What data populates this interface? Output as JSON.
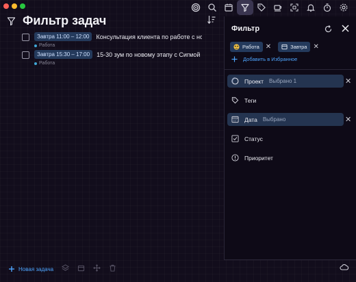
{
  "main": {
    "title": "Фильтр задач",
    "tasks": [
      {
        "time": "Завтра 11:00 – 12:00",
        "title": "Консультация клиента по работе с новым",
        "project": "Работа"
      },
      {
        "time": "Завтра 15:30 – 17:00",
        "title": "15-30 зум по новому этапу с Сигмой",
        "project": "Работа"
      }
    ],
    "new_task_label": "Новая задача"
  },
  "filter": {
    "title": "Фильтр",
    "chips": [
      {
        "label": "Работа",
        "icon": "face-emoji-icon"
      },
      {
        "label": "Завтра",
        "icon": "calendar-icon"
      }
    ],
    "add_favorite_label": "Добавить в Избранное",
    "rows": [
      {
        "label": "Проект",
        "sub": "Выбрано 1",
        "selected": true,
        "icon": "circle-progress-icon"
      },
      {
        "label": "Теги",
        "sub": "",
        "selected": false,
        "icon": "tag-icon"
      },
      {
        "label": "Дата",
        "sub": "Выбрано",
        "selected": true,
        "icon": "calendar-icon"
      },
      {
        "label": "Статус",
        "sub": "",
        "selected": false,
        "icon": "checkbox-icon"
      },
      {
        "label": "Приоритет",
        "sub": "",
        "selected": false,
        "icon": "exclamation-circle-icon"
      }
    ]
  },
  "colors": {
    "accent": "#4ea6ff",
    "badge": "#243a5c",
    "background": "#120d1c",
    "panel": "#0e0a17"
  }
}
